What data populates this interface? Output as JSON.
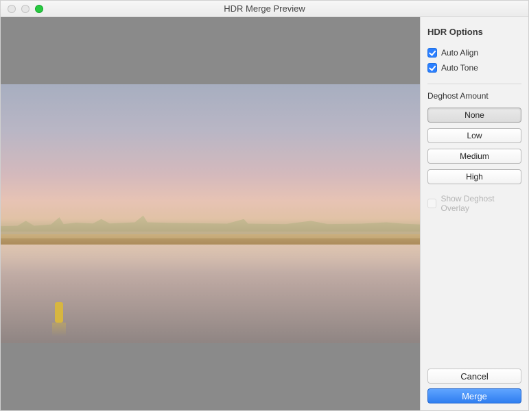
{
  "window": {
    "title": "HDR Merge Preview"
  },
  "sidebar": {
    "title": "HDR Options",
    "auto_align_label": "Auto Align",
    "auto_align_checked": true,
    "auto_tone_label": "Auto Tone",
    "auto_tone_checked": true,
    "deghost_label": "Deghost Amount",
    "deghost_options": {
      "none": "None",
      "low": "Low",
      "medium": "Medium",
      "high": "High"
    },
    "deghost_selected": "none",
    "show_overlay_label": "Show Deghost Overlay",
    "show_overlay_enabled": false
  },
  "footer": {
    "cancel_label": "Cancel",
    "merge_label": "Merge"
  }
}
